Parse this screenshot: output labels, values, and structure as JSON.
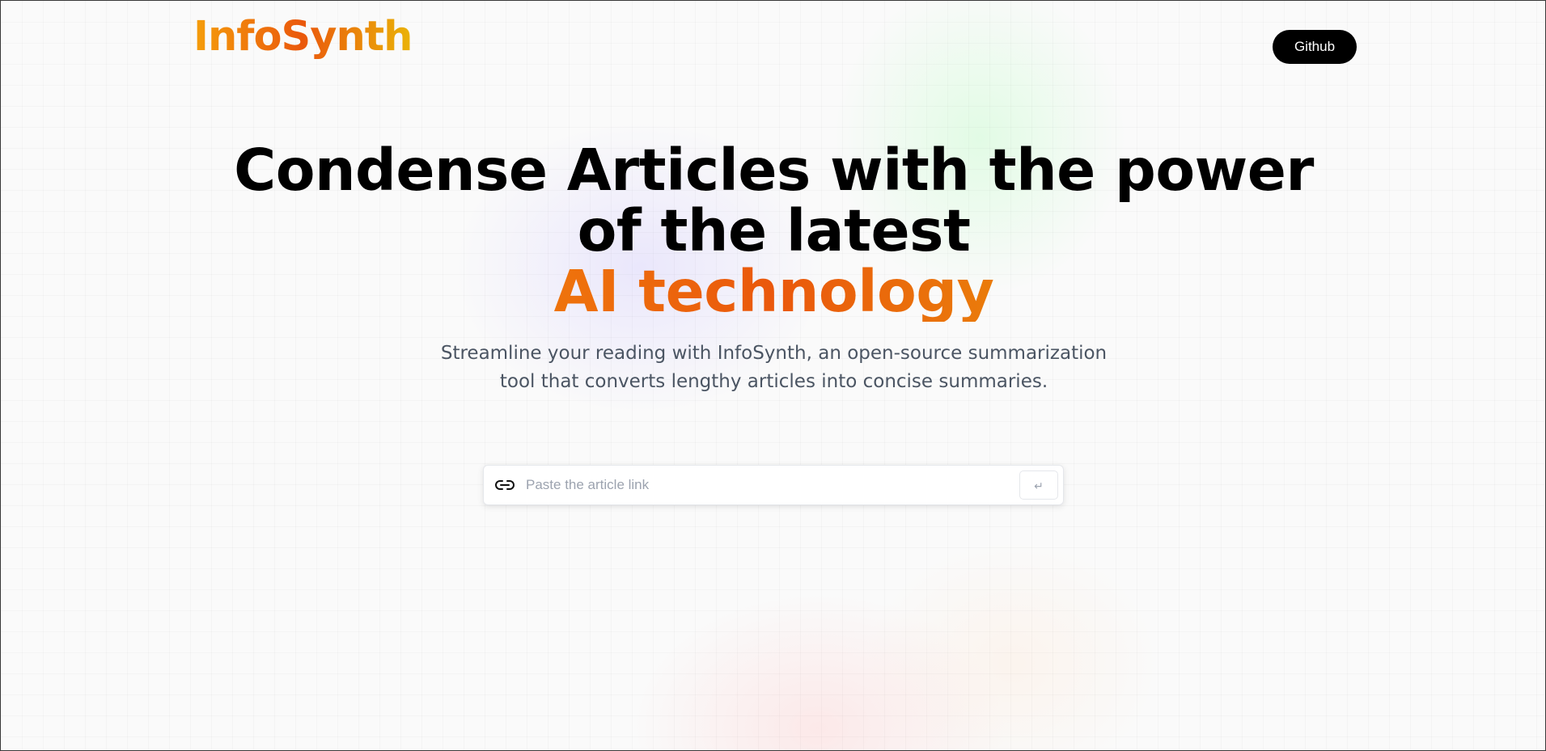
{
  "header": {
    "logo_text": "InfoSynth",
    "github_label": "Github"
  },
  "hero": {
    "headline_line1": "Condense Articles with the power of the latest",
    "headline_accent": "AI technology",
    "subtitle": "Streamline your reading with InfoSynth, an open-source summarization tool that converts lengthy articles into concise summaries."
  },
  "search": {
    "placeholder": "Paste the article link",
    "value": "",
    "link_icon": "link-icon",
    "submit_icon": "enter-icon",
    "submit_glyph": "↵"
  },
  "colors": {
    "accent_start": "#f59e0b",
    "accent_mid": "#ea580c",
    "accent_end": "#eab308",
    "button_bg": "#000000",
    "subtitle_text": "#4b5563"
  }
}
